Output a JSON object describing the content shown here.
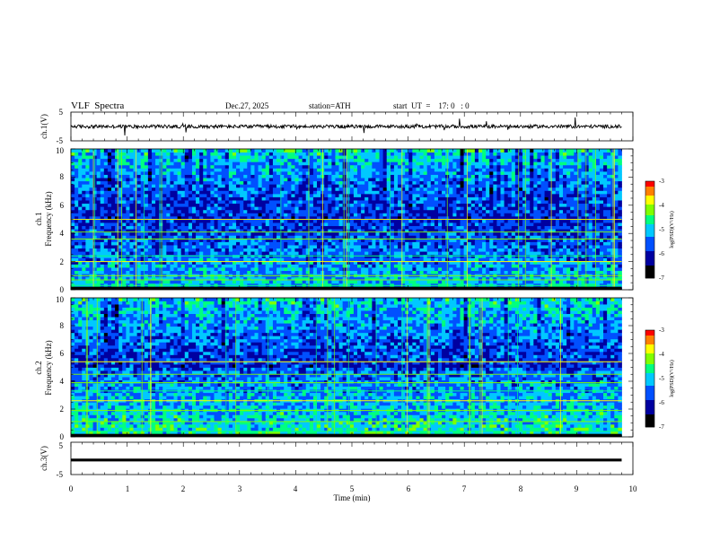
{
  "header": {
    "title": "VLF  Spectra",
    "date": "Dec.27, 2025",
    "station": "station=ATH",
    "start_ut": "start  UT  =    17: 0   : 0"
  },
  "chart_data": [
    {
      "type": "line",
      "panel": "ch1-waveform",
      "ylabel": "ch.1(V)",
      "ylim": [
        -5,
        5
      ],
      "y_ticks": [
        "5",
        "-5"
      ],
      "xlim": [
        0,
        10
      ],
      "series_color": "#000000",
      "baseline_v": 0,
      "noise_amplitude_v": 0.6,
      "data_end_min": 9.8
    },
    {
      "type": "heatmap",
      "panel": "ch1-spectrogram",
      "ylabel": "ch.1\nFrequency (kHz)",
      "ylabel_line1": "ch.1",
      "ylabel_line2": "Frequency (kHz)",
      "ylim": [
        0,
        10
      ],
      "y_ticks": [
        "0",
        "2",
        "4",
        "6",
        "8",
        "10"
      ],
      "xlim": [
        0,
        10
      ],
      "data_end_min": 9.8,
      "colorbar": {
        "label": "log(PSD)(V²/Hz)",
        "range": [
          -7,
          -3
        ],
        "ticks": [
          "-3",
          "-4",
          "-5",
          "-6",
          "-7"
        ],
        "colors": [
          "#000000",
          "#0000a0",
          "#0050ff",
          "#00c8ff",
          "#00ff80",
          "#80ff00",
          "#ffff00",
          "#ff8000",
          "#ff0000",
          "#ffffff"
        ]
      },
      "bands_khz": [
        0.3,
        0.7,
        1.0,
        2.0,
        2.4,
        3.6,
        4.1,
        5.0
      ]
    },
    {
      "type": "heatmap",
      "panel": "ch2-spectrogram",
      "ylabel_line1": "ch.2",
      "ylabel_line2": "Frequency (kHz)",
      "ylim": [
        0,
        10
      ],
      "y_ticks": [
        "0",
        "2",
        "4",
        "6",
        "8",
        "10"
      ],
      "xlim": [
        0,
        10
      ],
      "data_end_min": 9.8,
      "colorbar": {
        "label": "log(PSD)(V²/Hz)",
        "range": [
          -7,
          -3
        ],
        "ticks": [
          "-3",
          "-4",
          "-5",
          "-6",
          "-7"
        ],
        "colors": [
          "#000000",
          "#0000a0",
          "#0050ff",
          "#00c8ff",
          "#00ff80",
          "#80ff00",
          "#ffff00",
          "#ff8000",
          "#ff0000",
          "#ffffff"
        ]
      },
      "bands_khz": [
        0.4,
        1.1,
        1.9,
        2.6,
        3.3,
        3.9,
        4.5,
        5.4
      ]
    },
    {
      "type": "line",
      "panel": "ch3-waveform",
      "ylabel": "ch.3(V)",
      "ylim": [
        -5,
        5
      ],
      "y_ticks": [
        "5",
        "-5"
      ],
      "xlim": [
        0,
        10
      ],
      "xlabel": "Time  (min)",
      "x_ticks": [
        "0",
        "1",
        "2",
        "3",
        "4",
        "5",
        "6",
        "7",
        "8",
        "9",
        "10"
      ],
      "series_color": "#000000",
      "baseline_v": -0.5,
      "data_end_min": 9.8
    }
  ]
}
